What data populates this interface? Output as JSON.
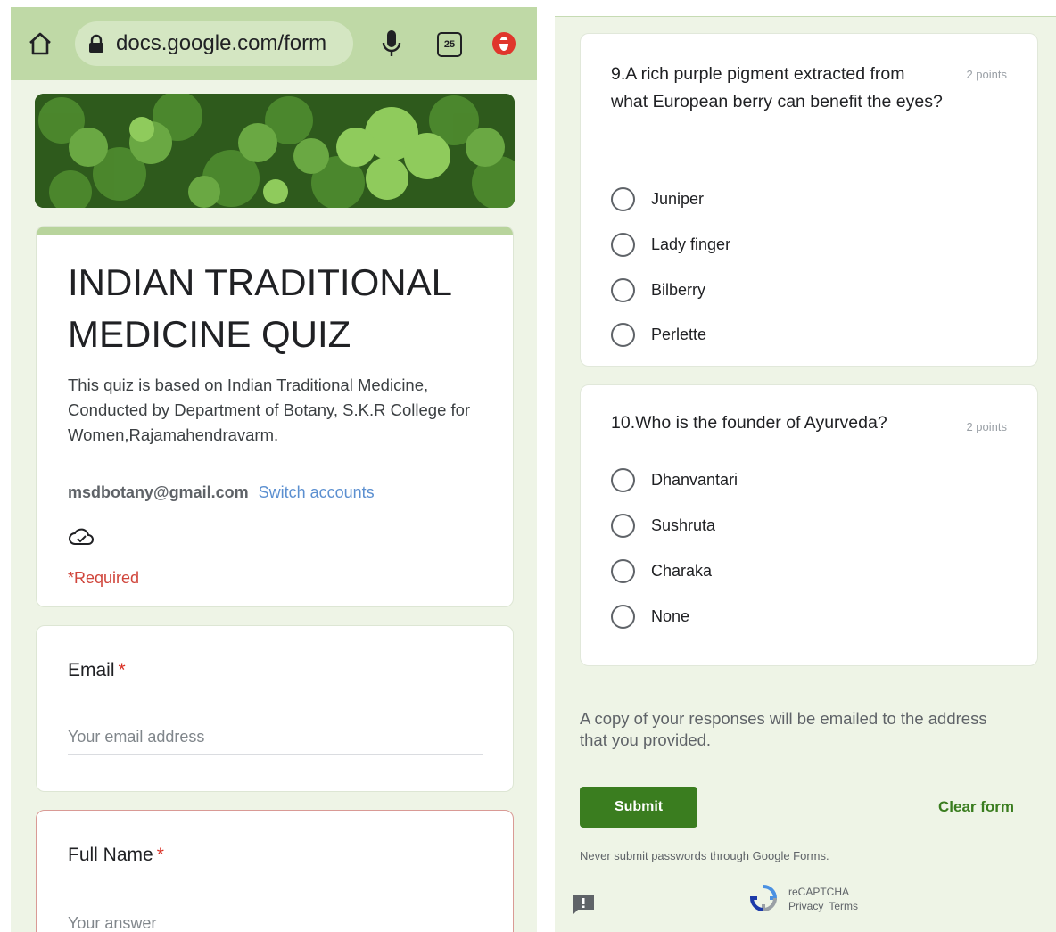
{
  "browser": {
    "url": "docs.google.com/form",
    "tab_count": "25"
  },
  "form": {
    "title": "INDIAN TRADITIONAL MEDICINE QUIZ",
    "description": "This quiz is based on Indian Traditional Medicine, Conducted by Department of Botany, S.K.R College for Women,Rajamahendravarm.",
    "account_email": "msdbotany@gmail.com",
    "switch_accounts": "Switch accounts",
    "required_note": "*Required"
  },
  "fields": {
    "email": {
      "label": "Email",
      "required_mark": "*",
      "placeholder": "Your email address"
    },
    "full_name": {
      "label": "Full Name",
      "required_mark": "*",
      "placeholder": "Your answer"
    }
  },
  "questions": [
    {
      "text": "9.A rich purple pigment extracted from what European berry can benefit the eyes?",
      "points": "2 points",
      "options": [
        "Juniper",
        "Lady finger",
        "Bilberry",
        "Perlette"
      ]
    },
    {
      "text": "10.Who is the founder of Ayurveda?",
      "points": "2 points",
      "options": [
        "Dhanvantari",
        "Sushruta",
        "Charaka",
        "None"
      ]
    }
  ],
  "footer": {
    "copy_note": "A copy of your responses will be emailed to the address that you provided.",
    "submit_label": "Submit",
    "clear_label": "Clear form",
    "warning": "Never submit passwords through Google Forms.",
    "recaptcha_label": "reCAPTCHA",
    "privacy_label": "Privacy",
    "terms_label": "Terms"
  }
}
